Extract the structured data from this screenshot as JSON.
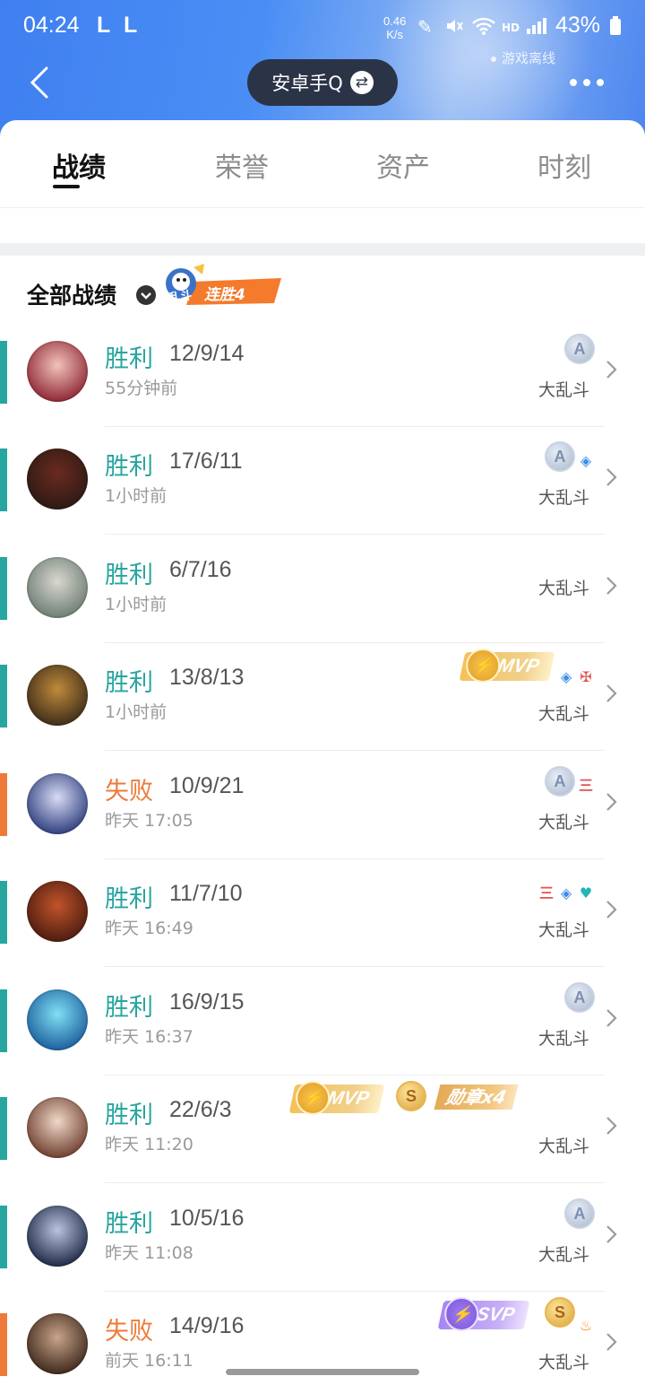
{
  "status_bar": {
    "time": "04:24",
    "indicators": [
      "L",
      "L"
    ],
    "net_speed_value": "0.46",
    "net_speed_unit": "K/s",
    "battery": "43%"
  },
  "header": {
    "account_label": "安卓手Q",
    "offline_text": "游戏离线"
  },
  "tabs": [
    {
      "label": "战绩",
      "active": true
    },
    {
      "label": "荣誉",
      "active": false
    },
    {
      "label": "资产",
      "active": false
    },
    {
      "label": "时刻",
      "active": false
    }
  ],
  "section": {
    "title": "全部战绩",
    "streak_mode": "乱斗",
    "streak_text": "连胜4"
  },
  "colors": {
    "win": "#27a59f",
    "lose": "#ee7a3a",
    "header_blue": "#4a8ef5"
  },
  "matches": [
    {
      "result": "胜利",
      "kda": "12/9/14",
      "time": "55分钟前",
      "mode": "大乱斗",
      "badges": [
        "A"
      ]
    },
    {
      "result": "胜利",
      "kda": "17/6/11",
      "time": "1小时前",
      "mode": "大乱斗",
      "badges": [
        "A",
        "blue-icon"
      ]
    },
    {
      "result": "胜利",
      "kda": "6/7/16",
      "time": "1小时前",
      "mode": "大乱斗",
      "badges": []
    },
    {
      "result": "胜利",
      "kda": "13/8/13",
      "time": "1小时前",
      "mode": "大乱斗",
      "badges": [
        "MVP",
        "blue-icon",
        "red-icon"
      ]
    },
    {
      "result": "失败",
      "kda": "10/9/21",
      "time": "昨天 17:05",
      "mode": "大乱斗",
      "badges": [
        "A",
        "三"
      ]
    },
    {
      "result": "胜利",
      "kda": "11/7/10",
      "time": "昨天 16:49",
      "mode": "大乱斗",
      "badges": [
        "三",
        "blue-icon",
        "teal-icon"
      ]
    },
    {
      "result": "胜利",
      "kda": "16/9/15",
      "time": "昨天 16:37",
      "mode": "大乱斗",
      "badges": [
        "A"
      ]
    },
    {
      "result": "胜利",
      "kda": "22/6/3",
      "time": "昨天 11:20",
      "mode": "大乱斗",
      "badges": [
        "MVP",
        "S",
        "勋章x4"
      ]
    },
    {
      "result": "胜利",
      "kda": "10/5/16",
      "time": "昨天 11:08",
      "mode": "大乱斗",
      "badges": [
        "A"
      ]
    },
    {
      "result": "失败",
      "kda": "14/9/16",
      "time": "前天 16:11",
      "mode": "大乱斗",
      "badges": [
        "SVP",
        "S",
        "orange-icon"
      ]
    }
  ],
  "badge_text": {
    "mvp": "MVP",
    "svp": "SVP",
    "a": "A",
    "s": "S",
    "triple": "三",
    "medals_count": "4",
    "medals_label": "勋章x4"
  }
}
